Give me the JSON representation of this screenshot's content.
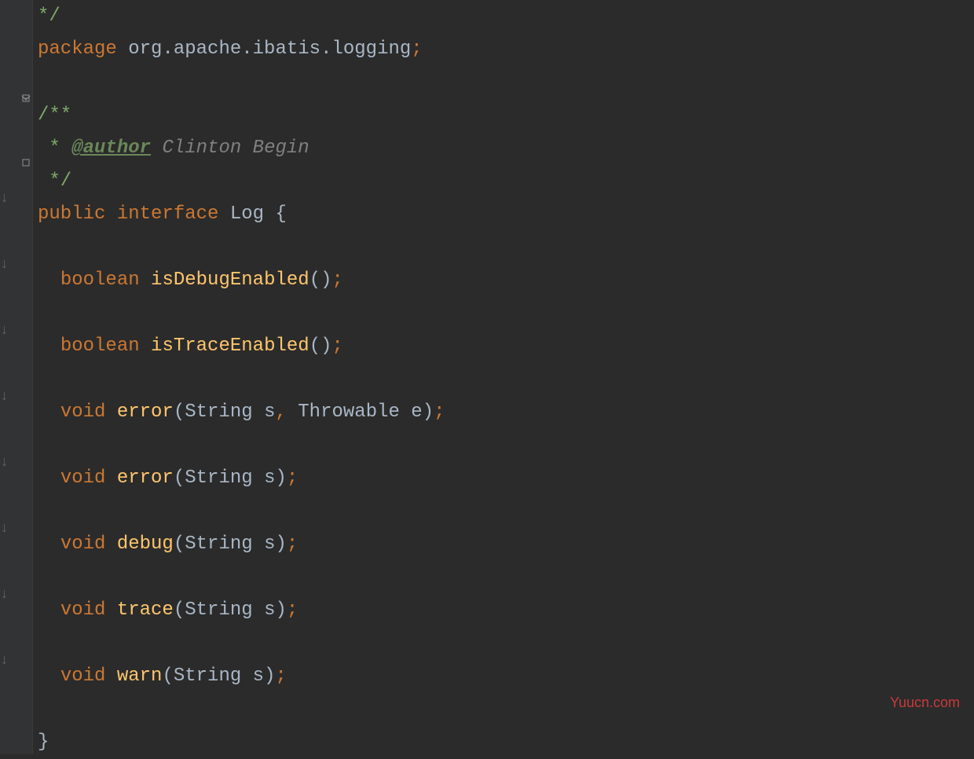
{
  "code": {
    "line0_comment_end": "*/",
    "line1_package": "package",
    "line1_pkg_name": " org.apache.ibatis.logging",
    "line1_semi": ";",
    "line2_blank": "",
    "line3_doc_open": "/**",
    "line4_star": " * ",
    "line4_author_tag": "@author",
    "line4_author_name": " Clinton Begin",
    "line5_doc_close": " */",
    "line6_public": "public",
    "line6_interface": " interface",
    "line6_name": " Log ",
    "line6_brace": "{",
    "line7_blank": "",
    "line8_indent": "  ",
    "line8_type": "boolean",
    "line8_method": " isDebugEnabled",
    "line8_paren": "()",
    "line8_semi": ";",
    "line9_blank": "",
    "line10_indent": "  ",
    "line10_type": "boolean",
    "line10_method": " isTraceEnabled",
    "line10_paren": "()",
    "line10_semi": ";",
    "line11_blank": "",
    "line12_indent": "  ",
    "line12_type": "void",
    "line12_method": " error",
    "line12_open": "(",
    "line12_param1": "String s",
    "line12_comma": ",",
    "line12_param2": " Throwable e",
    "line12_close": ")",
    "line12_semi": ";",
    "line13_blank": "",
    "line14_indent": "  ",
    "line14_type": "void",
    "line14_method": " error",
    "line14_open": "(",
    "line14_param": "String s",
    "line14_close": ")",
    "line14_semi": ";",
    "line15_blank": "",
    "line16_indent": "  ",
    "line16_type": "void",
    "line16_method": " debug",
    "line16_open": "(",
    "line16_param": "String s",
    "line16_close": ")",
    "line16_semi": ";",
    "line17_blank": "",
    "line18_indent": "  ",
    "line18_type": "void",
    "line18_method": " trace",
    "line18_open": "(",
    "line18_param": "String s",
    "line18_close": ")",
    "line18_semi": ";",
    "line19_blank": "",
    "line20_indent": "  ",
    "line20_type": "void",
    "line20_method": " warn",
    "line20_open": "(",
    "line20_param": "String s",
    "line20_close": ")",
    "line20_semi": ";",
    "line21_blank": "",
    "line22_brace": "}"
  },
  "watermark": "Yuucn.com"
}
